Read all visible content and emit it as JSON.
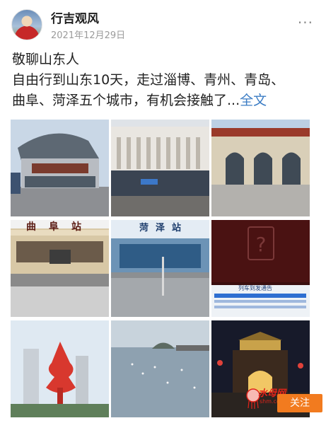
{
  "post": {
    "author": "行吉观风",
    "date": "2021年12月29日",
    "more_icon": "ellipsis-icon",
    "text_lines": [
      "敬聊山东人",
      "自由行到山东10天，走过淄博、青州、青岛、",
      "曲阜、菏泽五个城市，有机会接触了..."
    ],
    "fulltext_link": "全文"
  },
  "photos": {
    "captions": {
      "qufu_station": "曲阜站",
      "heze_station": "菏泽站",
      "board_title": "列车到发通告"
    }
  },
  "watermark": {
    "logo_text": "水母网",
    "logo_sub": "shm.com.cn",
    "follow_label": "关注"
  },
  "colors": {
    "link": "#3b7cc4",
    "follow_button": "#f27b1f",
    "logo": "#e2231a"
  }
}
